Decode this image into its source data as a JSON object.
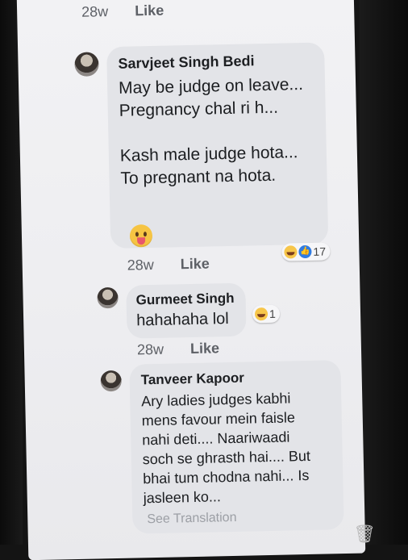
{
  "top_meta": {
    "time": "28w",
    "like_label": "Like"
  },
  "comments": [
    {
      "name": "Sarvjeet Singh Bedi",
      "text": "May be judge on leave...\nPregnancy chal ri h...\n\nKash male judge hota...\nTo pregnant na hota.",
      "time": "28w",
      "like_label": "Like",
      "reaction_count": "17"
    },
    {
      "name": "Gurmeet Singh",
      "text": "hahahaha lol",
      "time": "28w",
      "like_label": "Like",
      "reaction_count": "1"
    },
    {
      "name": "Tanveer Kapoor",
      "text": "Ary ladies judges kabhi\nmens favour mein faisle\nnahi deti.... Naariwaadi\nsoch se ghrasth hai.... But\nbhai tum chodna nahi... Is\njasleen ko...",
      "see_translation": "See Translation"
    }
  ]
}
